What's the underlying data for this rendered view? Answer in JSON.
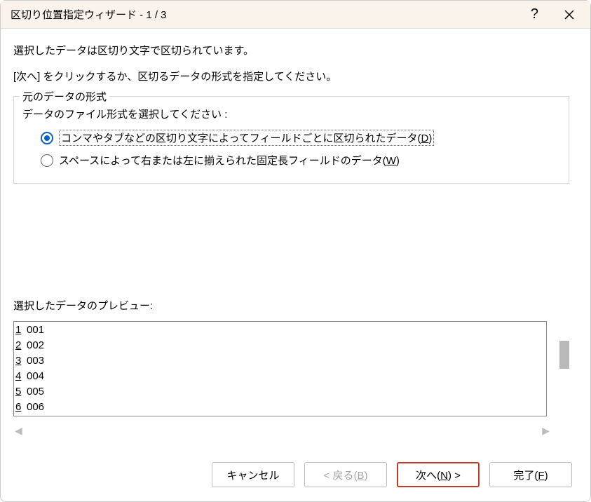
{
  "titlebar": {
    "title": "区切り位置指定ウィザード - 1 / 3",
    "help": "?",
    "close": "×"
  },
  "intro": {
    "line1": "選択したデータは区切り文字で区切られています。",
    "line2": "[次へ] をクリックするか、区切るデータの形式を指定してください。"
  },
  "fieldset": {
    "legend": "元のデータの形式",
    "prompt": "データのファイル形式を選択してください :",
    "option1_pre": "コンマやタブなどの区切り文字によってフィールドごとに区切られたデータ(",
    "option1_accel": "D",
    "option1_post": ")",
    "option2_pre": "スペースによって右または左に揃えられた固定長フィールドのデータ(",
    "option2_accel": "W",
    "option2_post": ")"
  },
  "preview": {
    "label": "選択したデータのプレビュー:",
    "rows": [
      {
        "num": "1",
        "val": "001"
      },
      {
        "num": "2",
        "val": "002"
      },
      {
        "num": "3",
        "val": "003"
      },
      {
        "num": "4",
        "val": "004"
      },
      {
        "num": "5",
        "val": "005"
      },
      {
        "num": "6",
        "val": "006"
      }
    ]
  },
  "buttons": {
    "cancel": "キャンセル",
    "back_pre": "< 戻る(",
    "back_accel": "B",
    "back_post": ")",
    "next_pre": "次へ(",
    "next_accel": "N",
    "next_post": ") >",
    "finish_pre": "完了(",
    "finish_accel": "F",
    "finish_post": ")"
  }
}
